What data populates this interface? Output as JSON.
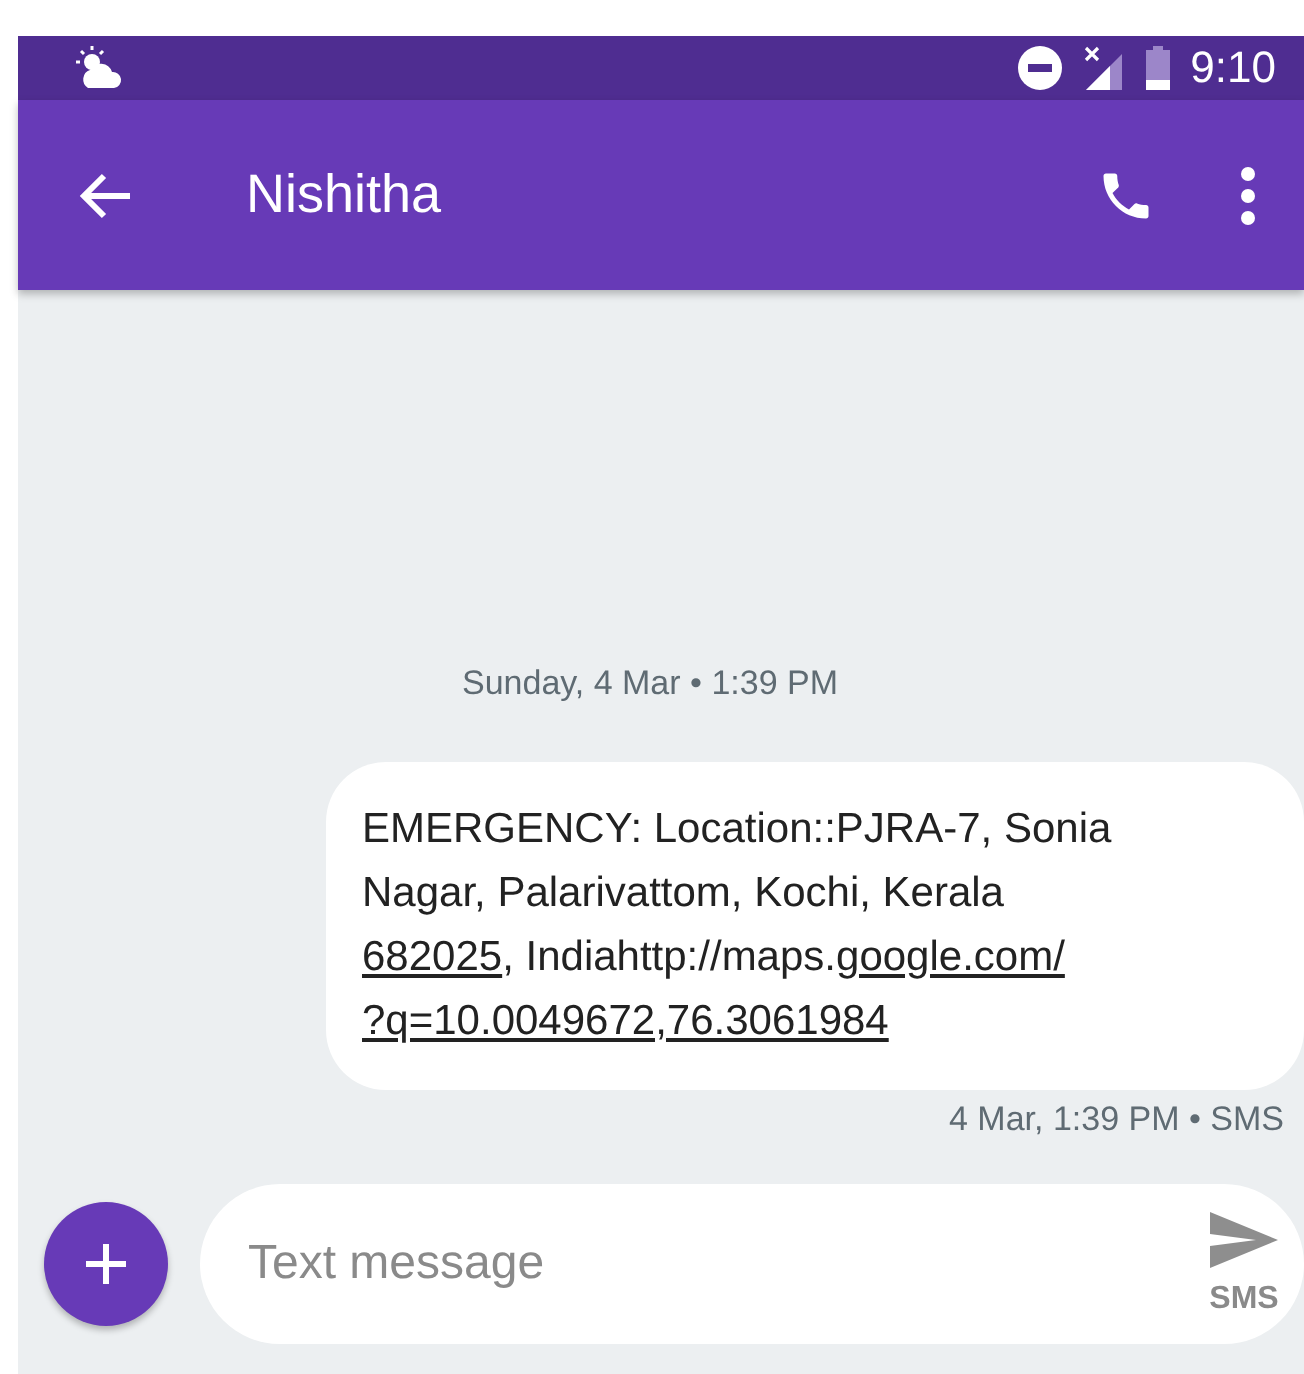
{
  "status_bar": {
    "time": "9:10"
  },
  "app_bar": {
    "title": "Nishitha"
  },
  "date_divider": "Sunday, 4 Mar • 1:39 PM",
  "message": {
    "segments": [
      {
        "text": "EMERGENCY: Location::PJRA-7, Sonia Nagar, Palarivattom, Kochi, Kerala ",
        "link": false
      },
      {
        "text": "682025",
        "link": true
      },
      {
        "text": ", Indiahttp://maps.",
        "link": false
      },
      {
        "text": "google.com/",
        "link": true
      },
      {
        "text": "?q=10.0049672,76.3061984",
        "link": true
      }
    ],
    "meta": "4 Mar, 1:39 PM • SMS"
  },
  "composer": {
    "placeholder": "Text message",
    "send_label": "SMS"
  }
}
